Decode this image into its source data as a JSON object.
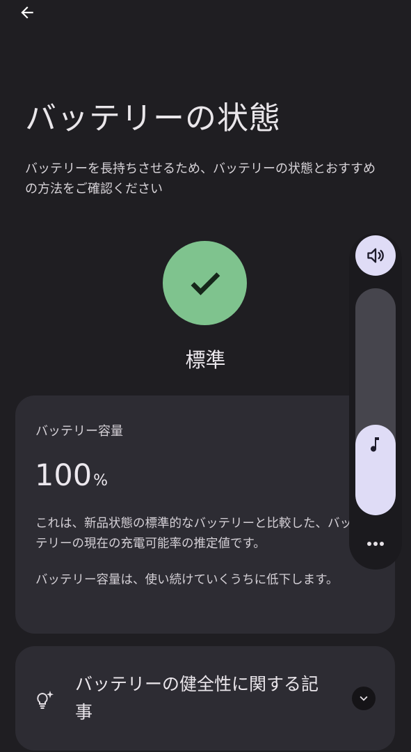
{
  "header": {
    "back_icon": "arrow-back-icon",
    "title": "バッテリーの状態",
    "subtitle": "バッテリーを長持ちさせるため、バッテリーの状態とおすすめの方法をご確認ください"
  },
  "status": {
    "icon": "check-icon",
    "label": "標準",
    "color": "#7fc38e"
  },
  "capacity_card": {
    "title": "バッテリー容量",
    "value": "100",
    "unit": "%",
    "description": "これは、新品状態の標準的なバッテリーと比較した、バッテリーの現在の充電可能率の推定値です。",
    "note": "バッテリー容量は、使い続けていくうちに低下します。"
  },
  "articles_card": {
    "icon": "lightbulb-icon",
    "label": "バッテリーの健全性に関する記事",
    "expand_icon": "chevron-down-icon"
  },
  "volume_panel": {
    "speaker_icon": "volume-up-icon",
    "stream_icon": "music-note-icon",
    "level": 0.4,
    "more_icon": "more-horiz-icon",
    "accent_color": "#dfdcf6"
  }
}
